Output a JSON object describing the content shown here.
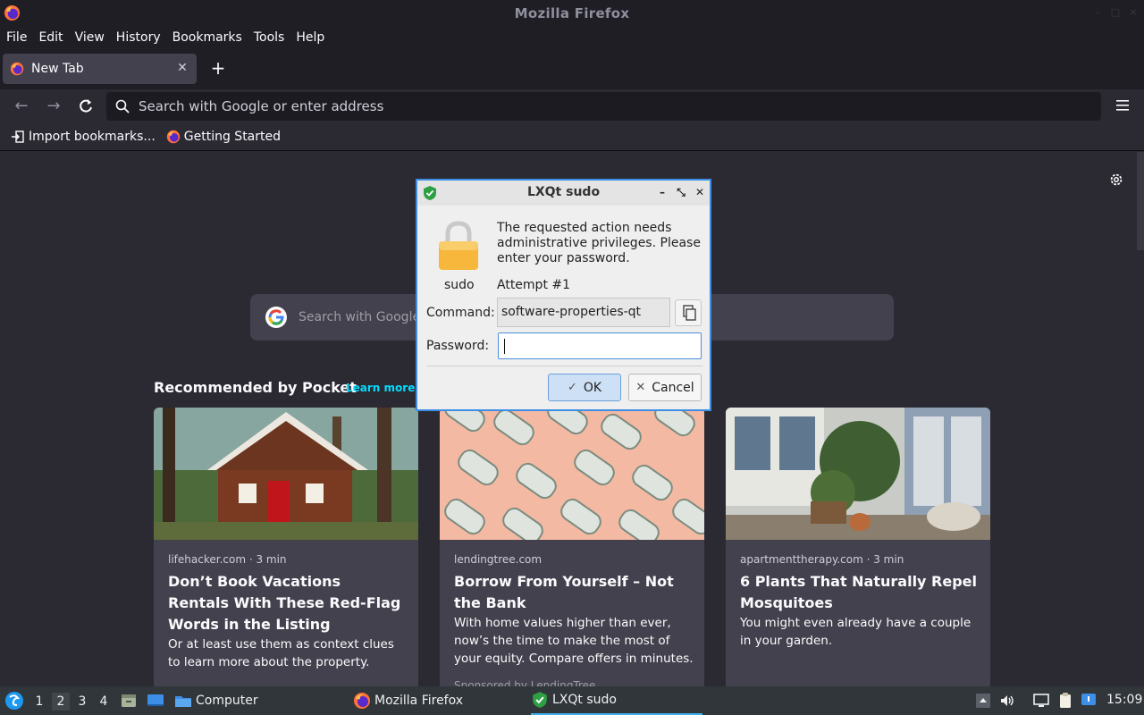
{
  "window": {
    "title": "Mozilla Firefox"
  },
  "menubar": {
    "items": [
      "File",
      "Edit",
      "View",
      "History",
      "Bookmarks",
      "Tools",
      "Help"
    ]
  },
  "tabs": [
    {
      "label": "New Tab"
    }
  ],
  "navbar": {
    "url_placeholder": "Search with Google or enter address"
  },
  "bookmarks": [
    {
      "label": "Import bookmarks..."
    },
    {
      "label": "Getting Started"
    }
  ],
  "newtab": {
    "search_placeholder": "Search with Google or enter address",
    "pocket_heading": "Recommended by Pocket",
    "pocket_learn_more": "Learn more",
    "cards": [
      {
        "meta": "lifehacker.com · 3 min",
        "title": "Don’t Book Vacations Rentals With These Red-Flag Words in the Listing",
        "excerpt": "Or at least use them as context clues to learn more about the property.",
        "footer": ""
      },
      {
        "meta": "lendingtree.com",
        "title": "Borrow From Yourself – Not the Bank",
        "excerpt": "With home values higher than ever, now’s the time to make the most of your equity. Compare offers in minutes.",
        "footer": "Sponsored by LendingTree"
      },
      {
        "meta": "apartmenttherapy.com · 3 min",
        "title": "6 Plants That Naturally Repel Mosquitoes",
        "excerpt": "You might even already have a couple in your garden.",
        "footer": ""
      }
    ]
  },
  "dialog": {
    "title": "LXQt sudo",
    "icon_label": "sudo",
    "message": "The requested action needs administrative privileges. Please enter your password.",
    "attempt": "Attempt #1",
    "command_label": "Command:",
    "command_value": "software-properties-qt",
    "password_label": "Password:",
    "password_value": "",
    "ok_label": "OK",
    "cancel_label": "Cancel"
  },
  "taskbar": {
    "desktops": [
      "1",
      "2",
      "3",
      "4"
    ],
    "active_desktop": "2",
    "tasks": [
      {
        "label": "Computer"
      },
      {
        "label": "Mozilla Firefox"
      },
      {
        "label": "LXQt sudo"
      }
    ],
    "clock": "15:09"
  },
  "colors": {
    "accent": "#3d8ee6",
    "pocket_link": "#00ddff",
    "taskbar_active": "#3daee9"
  }
}
